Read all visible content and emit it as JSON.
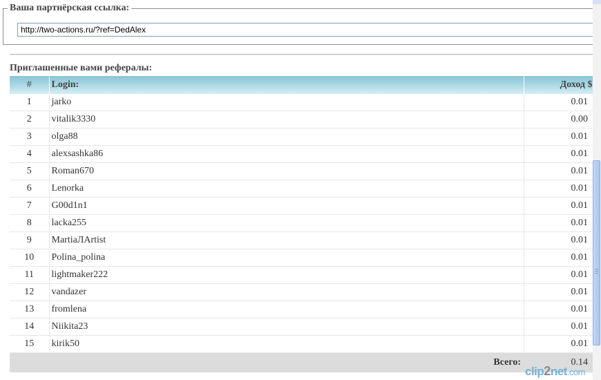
{
  "referral": {
    "legend": "Ваша партнёрская ссылка:",
    "link": "http://two-actions.ru/?ref=DedAlex"
  },
  "referrals_title": "Приглашенные вами рефералы:",
  "table": {
    "headers": {
      "num": "#",
      "login": "Login:",
      "income": "Доход $"
    },
    "rows": [
      {
        "num": "1",
        "login": "jarko",
        "income": "0.01"
      },
      {
        "num": "2",
        "login": "vitalik3330",
        "income": "0.00"
      },
      {
        "num": "3",
        "login": "olga88",
        "income": "0.01"
      },
      {
        "num": "4",
        "login": "alexsashka86",
        "income": "0.01"
      },
      {
        "num": "5",
        "login": "Roman670",
        "income": "0.01"
      },
      {
        "num": "6",
        "login": "Lenorka",
        "income": "0.01"
      },
      {
        "num": "7",
        "login": "G00d1n1",
        "income": "0.01"
      },
      {
        "num": "8",
        "login": "lacka255",
        "income": "0.01"
      },
      {
        "num": "9",
        "login": "MartiaЛArtist",
        "income": "0.01"
      },
      {
        "num": "10",
        "login": "Polina_polina",
        "income": "0.01"
      },
      {
        "num": "11",
        "login": "lightmaker222",
        "income": "0.01"
      },
      {
        "num": "12",
        "login": "vandazer",
        "income": "0.01"
      },
      {
        "num": "13",
        "login": "fromlena",
        "income": "0.01"
      },
      {
        "num": "14",
        "login": "Niikita23",
        "income": "0.01"
      },
      {
        "num": "15",
        "login": "kirik50",
        "income": "0.01"
      }
    ],
    "total_label": "Всего:",
    "total_value": "0.14"
  },
  "watermark": {
    "part1": "clip",
    "part2": "2",
    "part3": "net",
    "part4": ".com"
  }
}
